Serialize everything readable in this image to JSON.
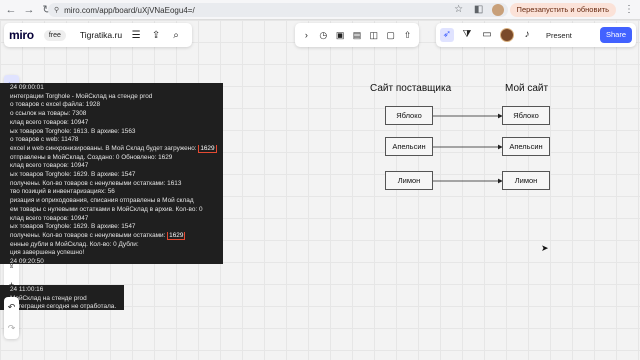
{
  "browser": {
    "url": "miro.com/app/board/uXjVNaEogu4=/",
    "restart_label": "Перезапустить и обновить"
  },
  "topbar": {
    "logo": "miro",
    "plan": "free",
    "board_name": "Tigratika.ru",
    "present_label": "Present",
    "share_label": "Share"
  },
  "log": {
    "lines": [
      "24 09:00:01",
      "интеграции Torghole - МойСклад на стенде prod",
      "о товаров с excel файла: 1928",
      "о ссылок на товары: 7308",
      "клад всего товаров: 10947",
      "ых товаров Torghole: 1613. В архиве: 1563",
      "о товаров с web: 11478",
      "excel и web синхронизированы. В Мой Склад будет загружено: ",
      "отправлены в МойСклад. Создано: 0 Обновлено: 1629",
      "клад всего товаров: 10947",
      "ых товаров Torghole: 1629. В архиве: 1547",
      "получены. Кол-во товаров с ненулевыми остатками: 1613",
      "тво позиций в инвентаризациях: 56",
      "ризация и оприходования, списания отправлены в Мой склад",
      "ем товары с нулевыми остатками в МойСклад в архив. Кол-во: 0",
      "клад всего товаров: 10947",
      "ых товаров Torghole: 1629. В архиве: 1547",
      "получены. Кол-во товаров с ненулевыми остатками: ",
      "енные дубли в МойСклад. Кол-во: 0 Дубли:",
      "ция завершена успешно!",
      "24 09:20:50"
    ],
    "highlight": "1629",
    "log2_lines": [
      "24 11:00:16",
      "МойСклад на стенде prod",
      "Интеграция сегодня не отработала."
    ]
  },
  "diagram": {
    "left_title": "Сайт поставщика",
    "right_title": "Мой сайт",
    "items": [
      "Яблоко",
      "Апельсин",
      "Лимон"
    ]
  }
}
